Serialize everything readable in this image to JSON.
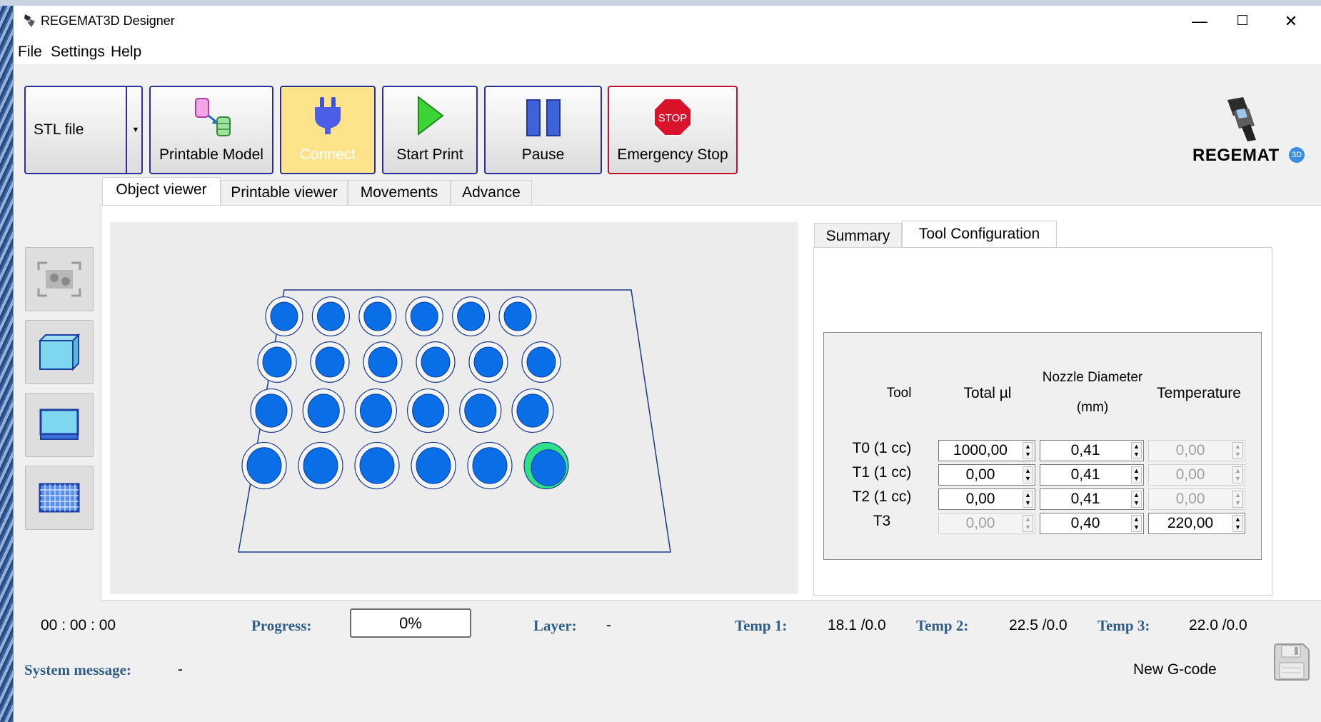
{
  "window": {
    "title": "REGEMAT3D Designer",
    "minimize": "—",
    "maximize": "☐",
    "close": "✕"
  },
  "menu": [
    "File",
    "Settings",
    "Help"
  ],
  "toolbar": {
    "stl_select": "STL file",
    "printable_model": "Printable Model",
    "connect": "Connect",
    "start_print": "Start Print",
    "pause": "Pause",
    "emergency_stop": "Emergency Stop",
    "stop_sign_text": "STOP"
  },
  "logo": {
    "text": "REGEMAT",
    "suffix": "3D"
  },
  "tabs": [
    "Object viewer",
    "Printable viewer",
    "Movements",
    "Advance"
  ],
  "right_tabs": [
    "Summary",
    "Tool Configuration"
  ],
  "tool_table": {
    "headers": {
      "tool": "Tool",
      "total": "Total µl",
      "nozzle": "Nozzle Diameter",
      "nozzle_unit": "(mm)",
      "temperature": "Temperature"
    },
    "rows": [
      {
        "tool": "T0 (1 cc)",
        "total": "1000,00",
        "total_enabled": true,
        "nozzle": "0,41",
        "temperature": "0,00",
        "temp_enabled": false
      },
      {
        "tool": "T1 (1 cc)",
        "total": "0,00",
        "total_enabled": true,
        "nozzle": "0,41",
        "temperature": "0,00",
        "temp_enabled": false
      },
      {
        "tool": "T2 (1 cc)",
        "total": "0,00",
        "total_enabled": true,
        "nozzle": "0,41",
        "temperature": "0,00",
        "temp_enabled": false
      },
      {
        "tool": "T3",
        "total": "0,00",
        "total_enabled": false,
        "nozzle": "0,40",
        "temperature": "220,00",
        "temp_enabled": true
      }
    ]
  },
  "status": {
    "time": "00 : 00 : 00",
    "progress_label": "Progress:",
    "progress_value": "0%",
    "progress_fraction": 0,
    "layer_label": "Layer:",
    "layer_value": "-",
    "temp1_label": "Temp 1:",
    "temp1_value": "18.1 /0.0",
    "temp2_label": "Temp 2:",
    "temp2_value": "22.5 /0.0",
    "temp3_label": "Temp 3:",
    "temp3_value": "22.0 /0.0",
    "system_message_label": "System message:",
    "system_message_value": "-",
    "gcode_label": "New G-code"
  },
  "wellplate": {
    "rows": 4,
    "cols": 6,
    "highlighted_well": [
      3,
      5
    ]
  },
  "colors": {
    "well_blue": "#0a6fe6",
    "well_highlight": "#2ee089",
    "button_border": "#2a2f9c",
    "connect_bg": "#fde38a",
    "stop_red": "#d8132a",
    "status_label": "#2f5d8a"
  }
}
